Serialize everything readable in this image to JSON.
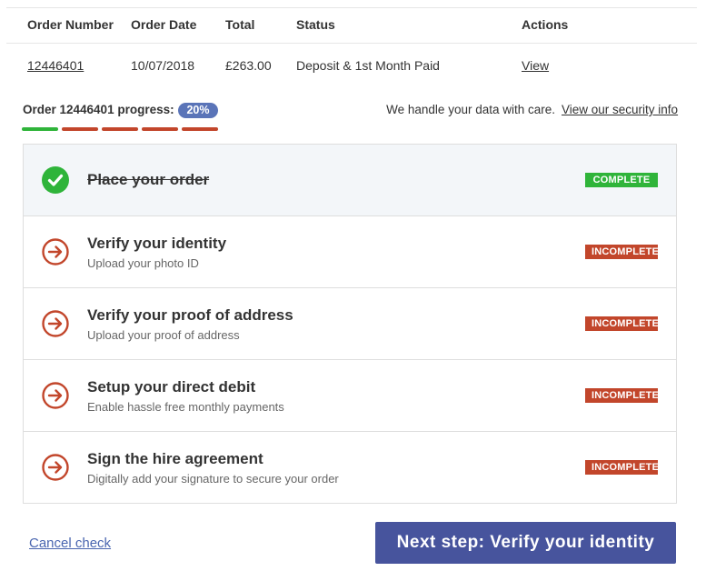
{
  "orders_table": {
    "headers": {
      "order_number": "Order Number",
      "order_date": "Order Date",
      "total": "Total",
      "status": "Status",
      "actions": "Actions"
    },
    "rows": [
      {
        "order_number": "12446401",
        "order_date": "10/07/2018",
        "total": "£263.00",
        "status": "Deposit & 1st Month Paid",
        "action": "View"
      }
    ]
  },
  "progress": {
    "label": "Order 12446401 progress:",
    "percent_text": "20%",
    "percent_value": 20,
    "segments": [
      "complete",
      "incomplete",
      "incomplete",
      "incomplete",
      "incomplete"
    ]
  },
  "security": {
    "text": "We handle your data with care.",
    "link": "View our security info"
  },
  "steps": [
    {
      "title": "Place your order",
      "subtitle": "",
      "status": "COMPLETE",
      "icon": "check-circle-icon"
    },
    {
      "title": "Verify your identity",
      "subtitle": "Upload your photo ID",
      "status": "INCOMPLETE",
      "icon": "arrow-right-circle-icon"
    },
    {
      "title": "Verify your proof of address",
      "subtitle": "Upload your proof of address",
      "status": "INCOMPLETE",
      "icon": "arrow-right-circle-icon"
    },
    {
      "title": "Setup your direct debit",
      "subtitle": "Enable hassle free monthly payments",
      "status": "INCOMPLETE",
      "icon": "arrow-right-circle-icon"
    },
    {
      "title": "Sign the hire agreement",
      "subtitle": "Digitally add your signature to secure your order",
      "status": "INCOMPLETE",
      "icon": "arrow-right-circle-icon"
    }
  ],
  "actions": {
    "cancel": "Cancel check",
    "next": "Next step: Verify your identity"
  },
  "colors": {
    "complete": "#2fb43a",
    "incomplete": "#c2462b",
    "primary": "#47549d",
    "pill": "#5a74b8",
    "link": "#4a66b0"
  }
}
